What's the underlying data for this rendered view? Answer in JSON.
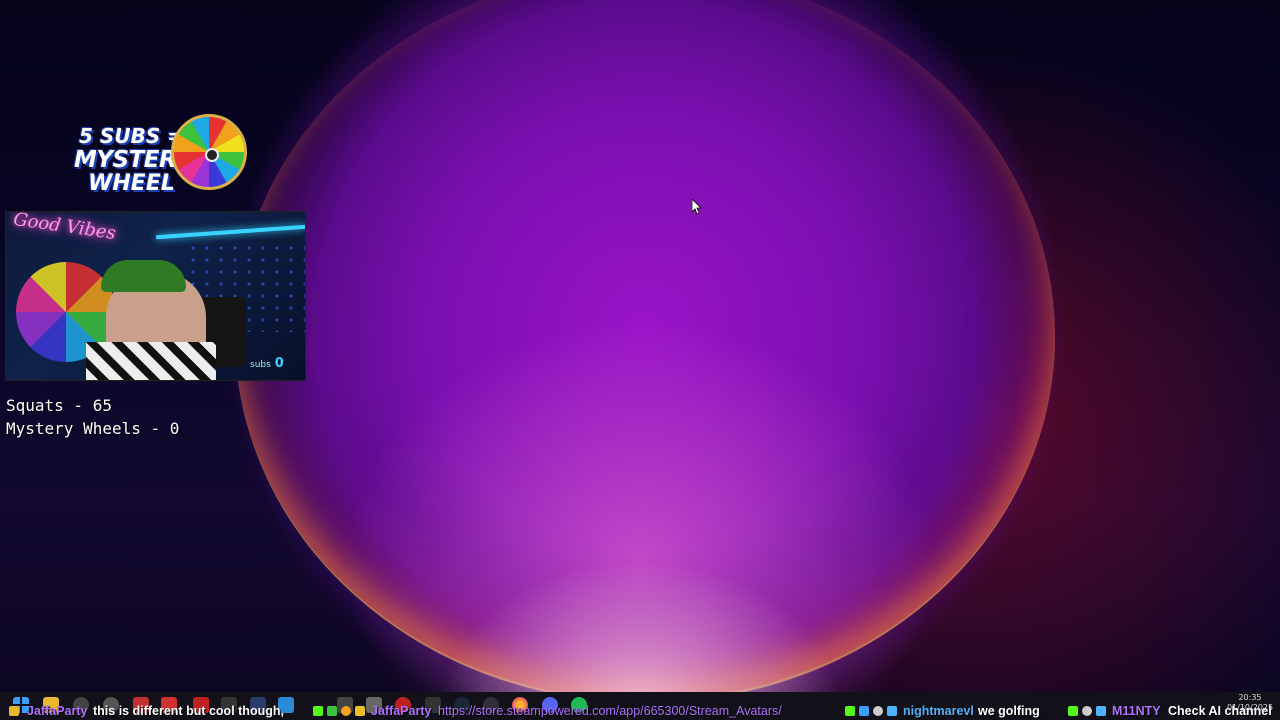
{
  "stream_overlay": {
    "promo": {
      "line1": "5 SUBS =",
      "line2": "MYSTERY",
      "line3": "WHEEL"
    },
    "webcam": {
      "neon_sign": "Good Vibes",
      "subs_label": "subs",
      "subs_count": "0"
    },
    "counters": {
      "squats": "Squats - 65",
      "mystery_wheels": "Mystery Wheels - 0"
    }
  },
  "chat_ticker": [
    {
      "user": "JaffaParty",
      "message": "this is different but cool though,"
    },
    {
      "user": "JaffaParty",
      "message": "https://store.steampowered.com/app/665300/Stream_Avatars/"
    },
    {
      "user": "nightmarevl",
      "message": "we golfing"
    },
    {
      "user": "M11NTY",
      "message": "Check AI channel"
    }
  ],
  "system_tray": {
    "time": "20:35",
    "date": "01/10/2025"
  },
  "colors": {
    "chat_user": "#b071ff",
    "chat_user_alt": "#4fb4ff",
    "taskbar": "#121018"
  },
  "icons": [
    "windows-start-icon",
    "file-explorer-icon",
    "firefox-icon",
    "discord-icon",
    "spotify-icon",
    "obs-icon",
    "steam-icon",
    "cursor-icon"
  ]
}
